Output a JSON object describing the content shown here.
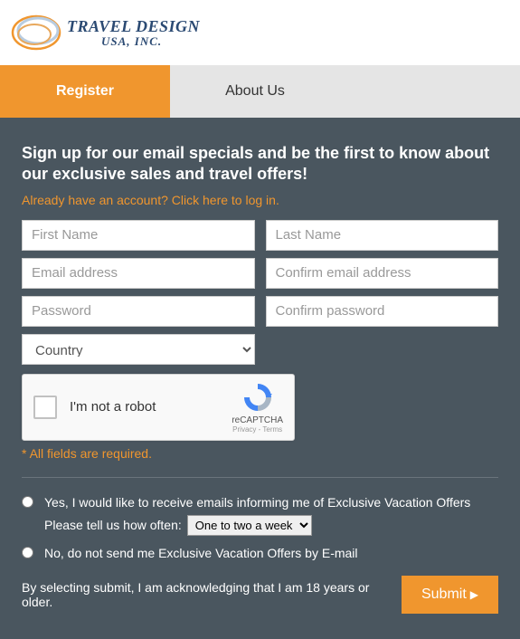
{
  "logo": {
    "line1": "TRAVEL DESIGN",
    "line2": "USA, INC."
  },
  "tabs": {
    "register": "Register",
    "about": "About Us"
  },
  "form": {
    "heading": "Sign up for our email specials and be the first to know about our exclusive sales and travel offers!",
    "login_link": "Already have an account? Click here to log in.",
    "first_name_ph": "First Name",
    "last_name_ph": "Last Name",
    "email_ph": "Email address",
    "confirm_email_ph": "Confirm email address",
    "password_ph": "Password",
    "confirm_password_ph": "Confirm password",
    "country_option": "Country",
    "recaptcha_label": "I'm not a robot",
    "recaptcha_brand": "reCAPTCHA",
    "recaptcha_terms": "Privacy - Terms",
    "required_note": "* All fields are required.",
    "opt_in_yes": "Yes, I would like to receive emails informing me of Exclusive Vacation Offers",
    "freq_label": "Please tell us how often:",
    "freq_option": "One to two a week",
    "opt_in_no": "No, do not send me Exclusive Vacation Offers by E-mail",
    "ack_text": "By selecting submit, I am acknowledging that I am 18 years or older.",
    "submit_label": "Submit"
  }
}
